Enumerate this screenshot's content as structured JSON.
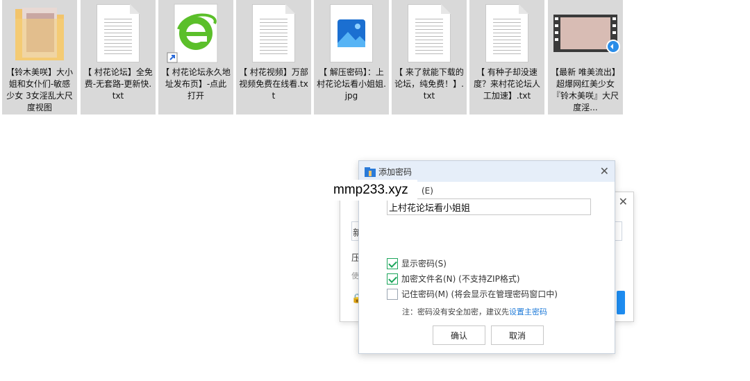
{
  "files": [
    {
      "name": "【铃木美咲】大小姐和女仆们-敏感少女 3女淫乱大尺度视图",
      "icon": "folder-icon"
    },
    {
      "name": "【 村花论坛】全免费-无套路-更新快.txt",
      "icon": "text-file-icon"
    },
    {
      "name": "【 村花论坛永久地址发布页】-点此打开",
      "icon": "ie-shortcut-icon"
    },
    {
      "name": "【 村花视频】万部视频免费在线看.txt",
      "icon": "text-file-icon"
    },
    {
      "name": "【 解压密码】：上村花论坛看小姐姐.jpg",
      "icon": "image-file-icon"
    },
    {
      "name": "【 来了就能下载的论坛，纯免费！】.txt",
      "icon": "text-file-icon"
    },
    {
      "name": "【 有种子却没速度？来村花论坛人工加速】.txt",
      "icon": "text-file-icon"
    },
    {
      "name": "【最新 唯美流出】超爆网红美少女『铃木美咲』大尺度淫...",
      "icon": "video-file-icon"
    }
  ],
  "watermark": "mmp233.xyz",
  "background_dialog": {
    "fragments": [
      "新",
      "压",
      "使"
    ]
  },
  "dialog": {
    "title": "添加密码",
    "password_label_suffix": "(E)",
    "password_value": "上村花论坛看小姐姐",
    "checkboxes": [
      {
        "label": "显示密码(S)",
        "checked": true
      },
      {
        "label": "加密文件名(N) (不支持ZIP格式)",
        "checked": true
      },
      {
        "label": "记住密码(M) (将会显示在管理密码窗口中)",
        "checked": false
      }
    ],
    "note_text": "注：密码没有安全加密，建议先",
    "note_link": "设置主密码",
    "ok_label": "确认",
    "cancel_label": "取消"
  },
  "colors": {
    "accent": "#1e7ad8",
    "check": "#1ba55b",
    "titlebar": "#e6eef9"
  }
}
